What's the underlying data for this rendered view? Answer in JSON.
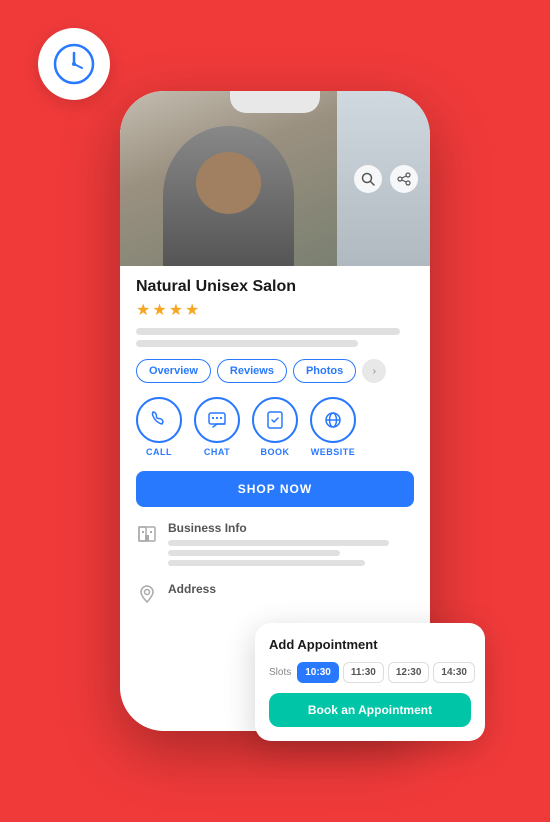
{
  "background_color": "#F03A3A",
  "clock_badge": {
    "aria": "clock-icon"
  },
  "phone": {
    "salon_name": "Natural Unisex Salon",
    "stars": [
      "★",
      "★",
      "★",
      "★"
    ],
    "tabs": [
      {
        "label": "Overview",
        "active": true
      },
      {
        "label": "Reviews",
        "active": false
      },
      {
        "label": "Photos",
        "active": false
      }
    ],
    "actions": [
      {
        "label": "CALL",
        "icon": "phone"
      },
      {
        "label": "CHAT",
        "icon": "chat"
      },
      {
        "label": "BOOK",
        "icon": "book"
      },
      {
        "label": "WEBSITE",
        "icon": "globe"
      }
    ],
    "shop_now_label": "SHOP NOW",
    "business_info_label": "Business Info",
    "address_label": "Address"
  },
  "appointment_card": {
    "title": "Add Appointment",
    "slots_label": "Slots",
    "slots": [
      {
        "time": "10:30",
        "active": true
      },
      {
        "time": "11:30",
        "active": false
      },
      {
        "time": "12:30",
        "active": false
      },
      {
        "time": "14:30",
        "active": false
      }
    ],
    "book_button_label": "Book an Appointment"
  }
}
